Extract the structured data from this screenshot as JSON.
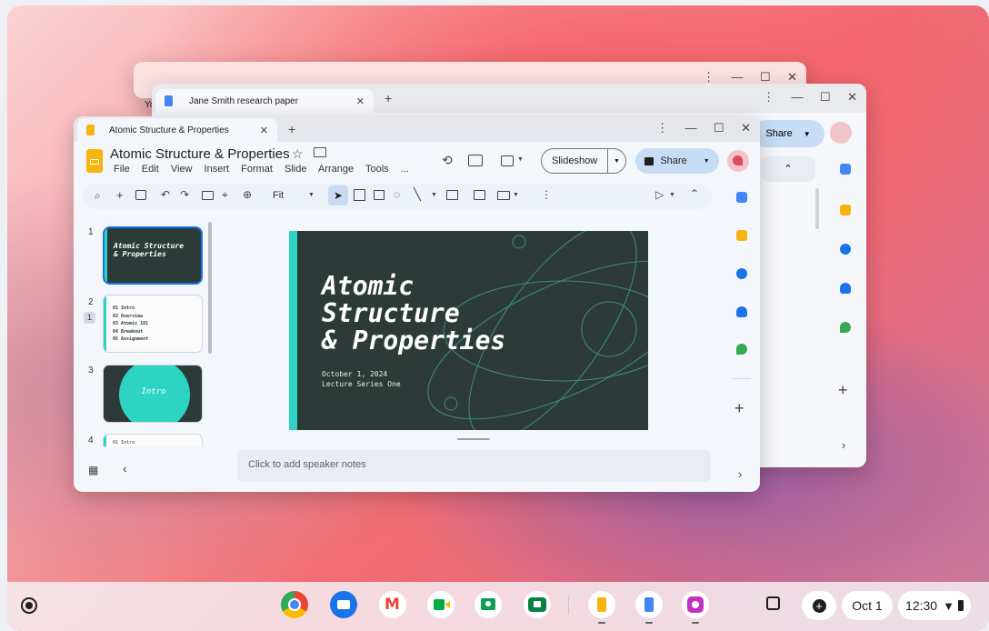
{
  "back_window": {
    "partial_tab_label": "Yo"
  },
  "middle_window": {
    "tab_title": "Jane Smith research paper",
    "share_label": "Share"
  },
  "slides_window": {
    "tab_title": "Atomic Structure & Properties",
    "doc_title": "Atomic Structure & Properties",
    "menu": [
      "File",
      "Edit",
      "View",
      "Insert",
      "Format",
      "Slide",
      "Arrange",
      "Tools",
      "..."
    ],
    "slideshow_label": "Slideshow",
    "share_label": "Share",
    "zoom_label": "Fit",
    "slide_numbers": [
      "1",
      "2",
      "3",
      "4"
    ],
    "slide2_badge": "1",
    "thumb1_title": "Atomic Structure & Properties",
    "thumb2_lines": [
      "01 Intro",
      "02 Overview",
      "03 Atomic 101",
      "04 Breakout",
      "05 Assignment"
    ],
    "thumb3_label": "Intro",
    "thumb4_partial": "01 Intro",
    "slide": {
      "title_lines": [
        "Atomic",
        "Structure",
        "& Properties"
      ],
      "subtitle_lines": [
        "October 1, 2024",
        "Lecture Series One"
      ]
    },
    "speaker_notes_placeholder": "Click to add speaker notes"
  },
  "taskbar": {
    "date": "Oct 1",
    "time": "12:30"
  },
  "colors": {
    "slide_bg": "#2d3b38",
    "slide_accent": "#2dd4c4",
    "share_bg": "#c6ddf5",
    "slides_yellow": "#f6b50e"
  }
}
